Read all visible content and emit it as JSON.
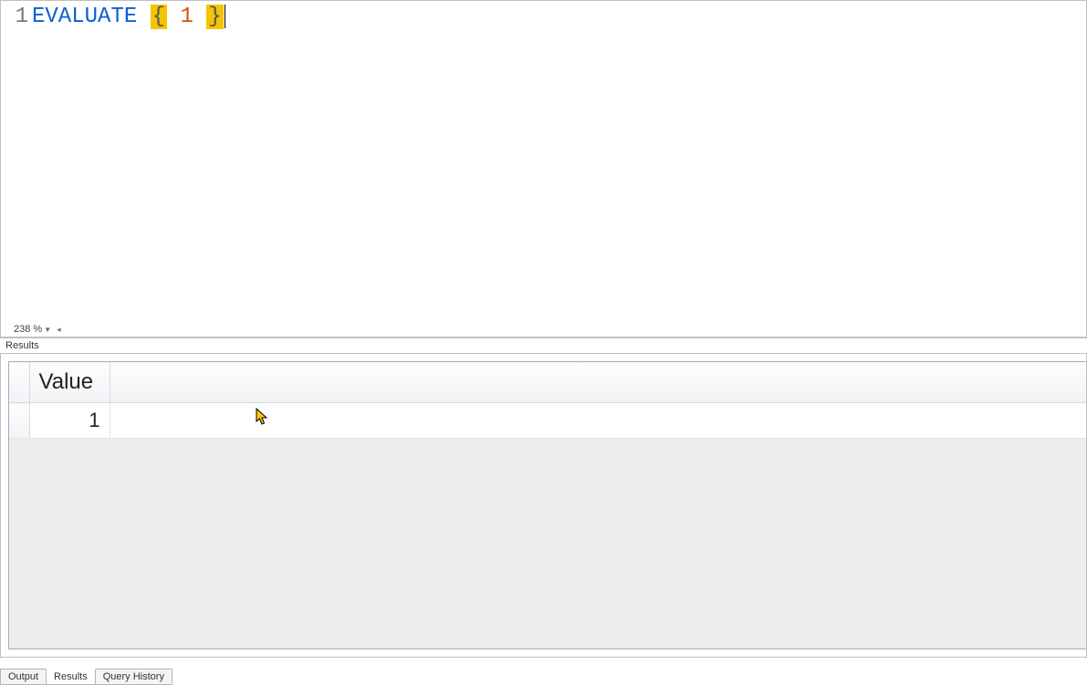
{
  "editor": {
    "line_number": "1",
    "tokens": {
      "keyword": "EVALUATE",
      "open_brace": "{",
      "number": "1",
      "close_brace": "}"
    },
    "zoom_level": "238 %"
  },
  "results": {
    "panel_label": "Results",
    "columns": [
      "Value"
    ],
    "rows": [
      {
        "Value": "1"
      }
    ]
  },
  "tabs": {
    "output": "Output",
    "results": "Results",
    "query_history": "Query History",
    "active": "results"
  }
}
